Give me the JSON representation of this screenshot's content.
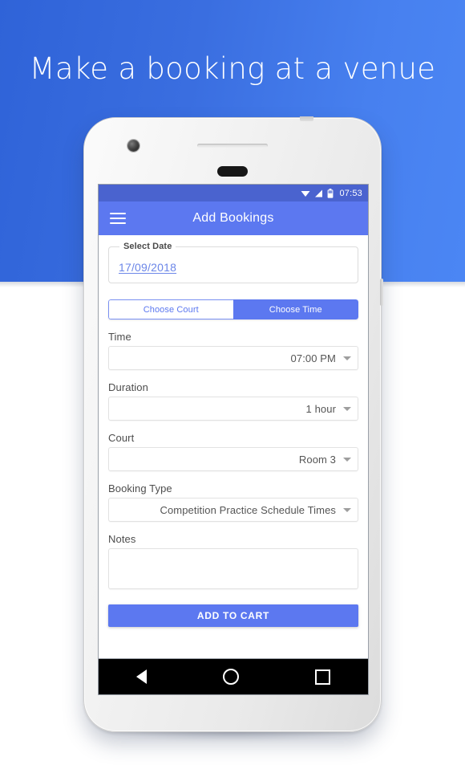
{
  "hero": {
    "title": "Make a booking at a venue",
    "bg_color_left": "#2f63d8",
    "bg_color_right": "#4b86f4"
  },
  "phone": {
    "status_bar": {
      "time": "07:53",
      "icons": [
        "wifi-icon",
        "signal-icon",
        "battery-icon"
      ],
      "background": "#4a63cf"
    },
    "app_bar": {
      "menu_icon": "hamburger-menu-icon",
      "title": "Add Bookings",
      "background": "#5c78f0"
    },
    "nav_bar": {
      "back_label": "Back",
      "home_label": "Home",
      "recents_label": "Recent apps"
    }
  },
  "form": {
    "date_card": {
      "legend": "Select Date",
      "value": "17/09/2018",
      "value_color": "#6b86e8"
    },
    "segmented": {
      "options": [
        {
          "label": "Choose Court",
          "selected": false
        },
        {
          "label": "Choose Time",
          "selected": true
        }
      ],
      "active_color": "#5c78f0"
    },
    "fields": [
      {
        "label": "Time",
        "value": "07:00 PM",
        "type": "dropdown"
      },
      {
        "label": "Duration",
        "value": "1 hour",
        "type": "dropdown"
      },
      {
        "label": "Court",
        "value": "Room 3",
        "type": "dropdown"
      },
      {
        "label": "Booking Type",
        "value": "Competition Practice Schedule Times",
        "type": "dropdown"
      }
    ],
    "notes": {
      "label": "Notes",
      "value": "",
      "placeholder": ""
    },
    "submit": {
      "label": "ADD TO CART",
      "color": "#5c78f0"
    }
  }
}
